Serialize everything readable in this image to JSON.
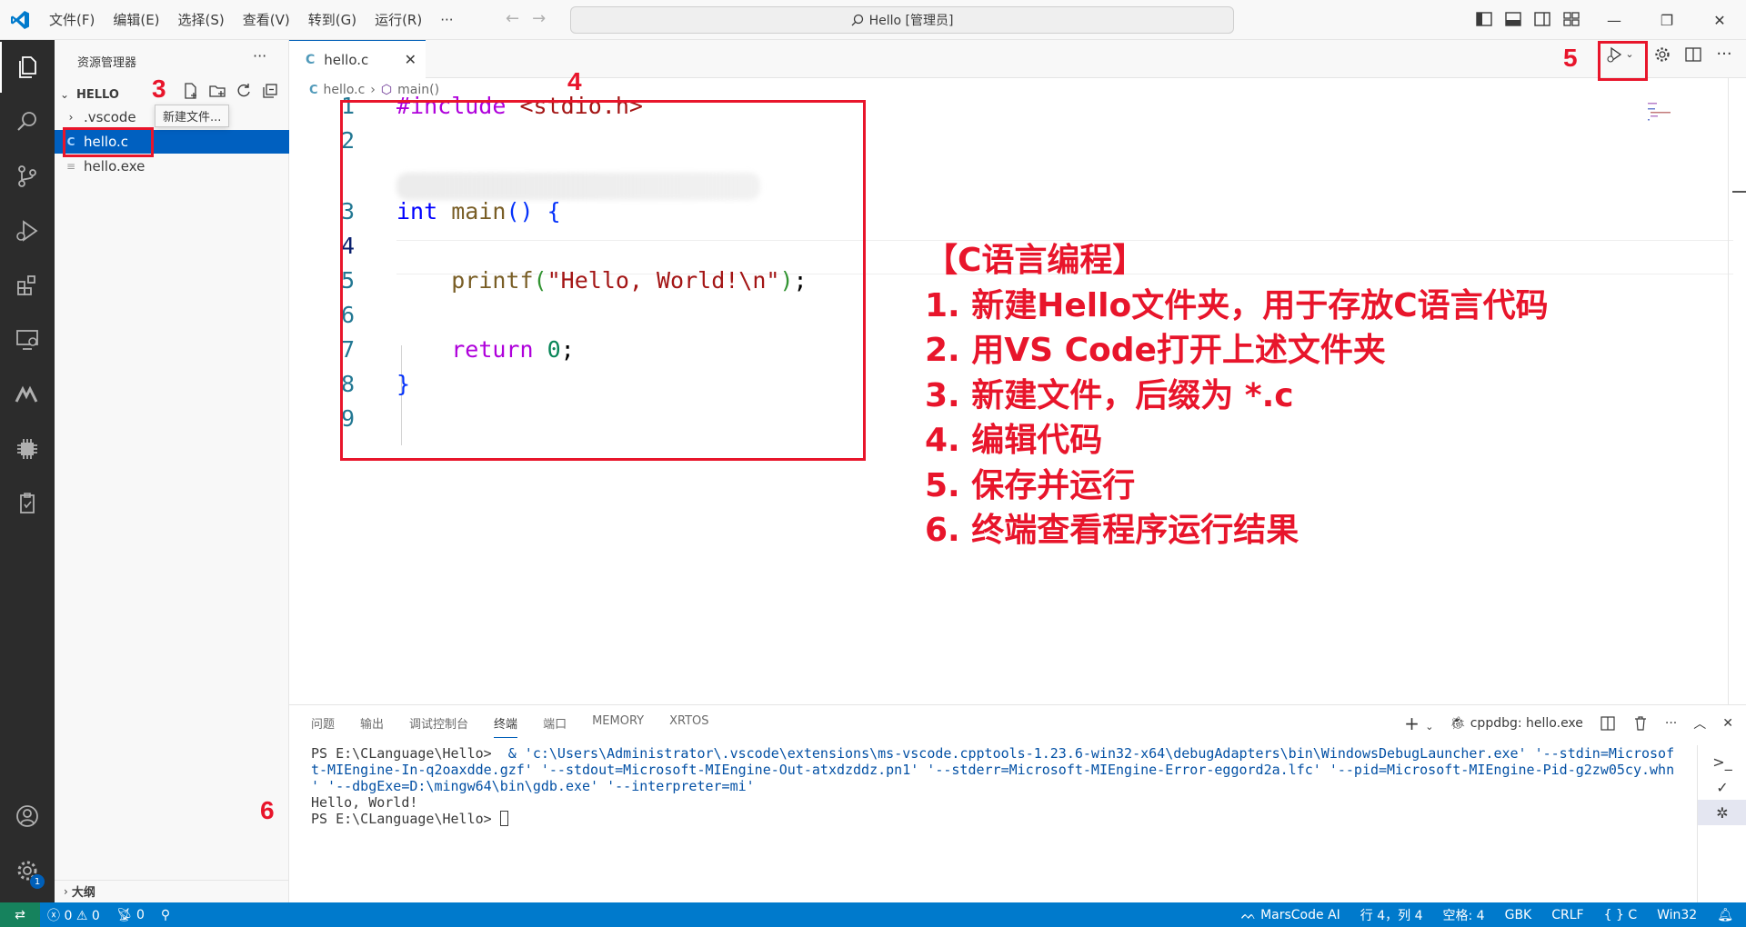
{
  "titlebar": {
    "menus": [
      "文件(F)",
      "编辑(E)",
      "选择(S)",
      "查看(V)",
      "转到(G)",
      "运行(R)",
      "···"
    ],
    "command_center": "Hello [管理员]"
  },
  "sidebar": {
    "title": "资源管理器",
    "more": "···",
    "folder_name": "HELLO",
    "tooltip": "新建文件...",
    "items": [
      {
        "label": ".vscode",
        "type": "folder"
      },
      {
        "label": "hello.c",
        "type": "c-file"
      },
      {
        "label": "hello.exe",
        "type": "file"
      }
    ],
    "outline_label": "大纲"
  },
  "editor": {
    "tab_label": "hello.c",
    "tab_icon_letter": "C",
    "breadcrumb": {
      "file": "hello.c",
      "symbol": "main()"
    },
    "lines": [
      {
        "num": "1",
        "parts": [
          [
            "kw-purple",
            "#include "
          ],
          [
            "str",
            "<stdio.h>"
          ]
        ]
      },
      {
        "num": "2",
        "parts": []
      },
      {
        "num": "3",
        "parts": [
          [
            "kw-blue",
            "int "
          ],
          [
            "fn",
            "main"
          ],
          [
            "br-yellow",
            "() {"
          ]
        ]
      },
      {
        "num": "4",
        "parts": []
      },
      {
        "num": "5",
        "parts": [
          [
            "plain",
            "    "
          ],
          [
            "fn",
            "printf"
          ],
          [
            "br-purple",
            "("
          ],
          [
            "str",
            "\"Hello, World!\\n\""
          ],
          [
            "br-purple",
            ")"
          ],
          [
            "plain",
            ";"
          ]
        ]
      },
      {
        "num": "6",
        "parts": []
      },
      {
        "num": "7",
        "parts": [
          [
            "plain",
            "    "
          ],
          [
            "kw-purple",
            "return "
          ],
          [
            "num",
            "0"
          ],
          [
            "plain",
            ";"
          ]
        ]
      },
      {
        "num": "8",
        "parts": [
          [
            "br-yellow",
            "}"
          ]
        ]
      },
      {
        "num": "9",
        "parts": []
      }
    ],
    "active_line": "4"
  },
  "annotations": {
    "n3": "3",
    "n4": "4",
    "n5": "5",
    "n6": "6",
    "notes": [
      "【C语言编程】",
      "1. 新建Hello文件夹，用于存放C语言代码",
      "2. 用VS Code打开上述文件夹",
      "3. 新建文件，后缀为 *.c",
      "4. 编辑代码",
      "5. 保存并运行",
      "6. 终端查看程序运行结果"
    ]
  },
  "panel": {
    "tabs": [
      "问题",
      "输出",
      "调试控制台",
      "终端",
      "端口",
      "MEMORY",
      "XRTOS"
    ],
    "active_tab": "终端",
    "debug_session": "cppdbg: hello.exe",
    "terminal": {
      "prompt": "PS E:\\CLanguage\\Hello> ",
      "command_line1": " & 'c:\\Users\\Administrator\\.vscode\\extensions\\ms-vscode.cpptools-1.23.6-win32-x64\\debugAdapters\\bin\\WindowsDebugLauncher.exe' '--stdin=Microsof",
      "command_line2": "t-MIEngine-In-q2oaxdde.gzf' '--stdout=Microsoft-MIEngine-Out-atxdzddz.pn1' '--stderr=Microsoft-MIEngine-Error-eggord2a.lfc' '--pid=Microsoft-MIEngine-Pid-g2zw05cy.whn",
      "command_line3": "' '--dbgExe=D:\\mingw64\\bin\\gdb.exe' '--interpreter=mi'",
      "output": "Hello, World!",
      "prompt2": "PS E:\\CLanguage\\Hello> "
    }
  },
  "statusbar": {
    "errors": "0",
    "warnings": "0",
    "ports": "0",
    "marscode": "MarsCode AI",
    "position": "行 4，列 4",
    "spaces": "空格: 4",
    "encoding": "GBK",
    "eol": "CRLF",
    "language": "C",
    "platform": "Win32"
  },
  "activity_badge": "1"
}
